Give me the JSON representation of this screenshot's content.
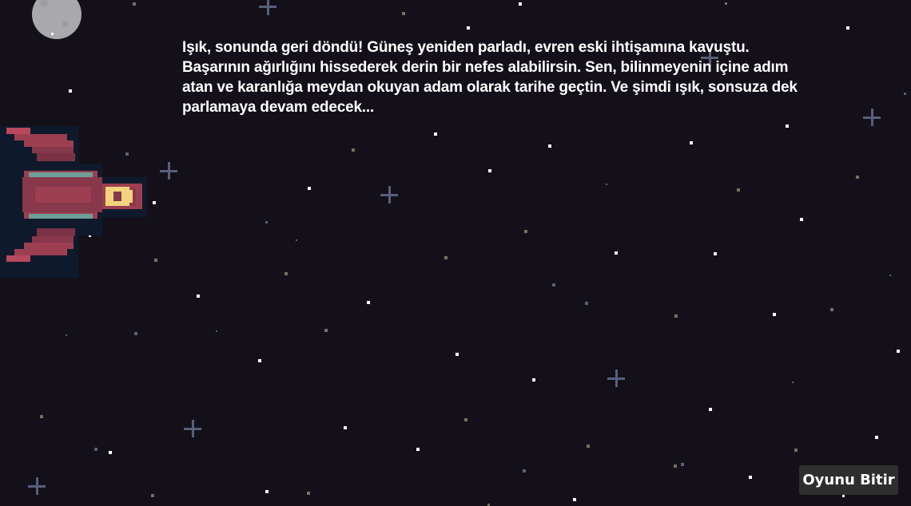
{
  "story": {
    "text": "Işık, sonunda geri döndü! Güneş yeniden parladı, evren eski ihtişamına kavuştu. Başarının ağırlığını hissederek derin bir nefes alabilirsin. Sen, bilinmeyenin içine adım atan ve karanlığa meydan okuyan adam olarak tarihe geçtin. Ve şimdi ışık, sonsuza dek parlamaya devam edecek..."
  },
  "buttons": {
    "end_game": "Oyunu Bitir"
  },
  "colors": {
    "background": "#141019",
    "star_white": "#ffffff",
    "star_dim": "#77705f",
    "sparkle": "#56607a",
    "moon": "#a9a9ad",
    "ship_hull": "#9c3f51",
    "ship_stripe": "#6d9e97",
    "ship_cockpit": "#f3d47c",
    "button_bg": "#2e2e2e"
  },
  "icons": {
    "moon": "moon-icon",
    "spaceship": "spaceship-icon",
    "sparkle": "sparkle-icon"
  }
}
